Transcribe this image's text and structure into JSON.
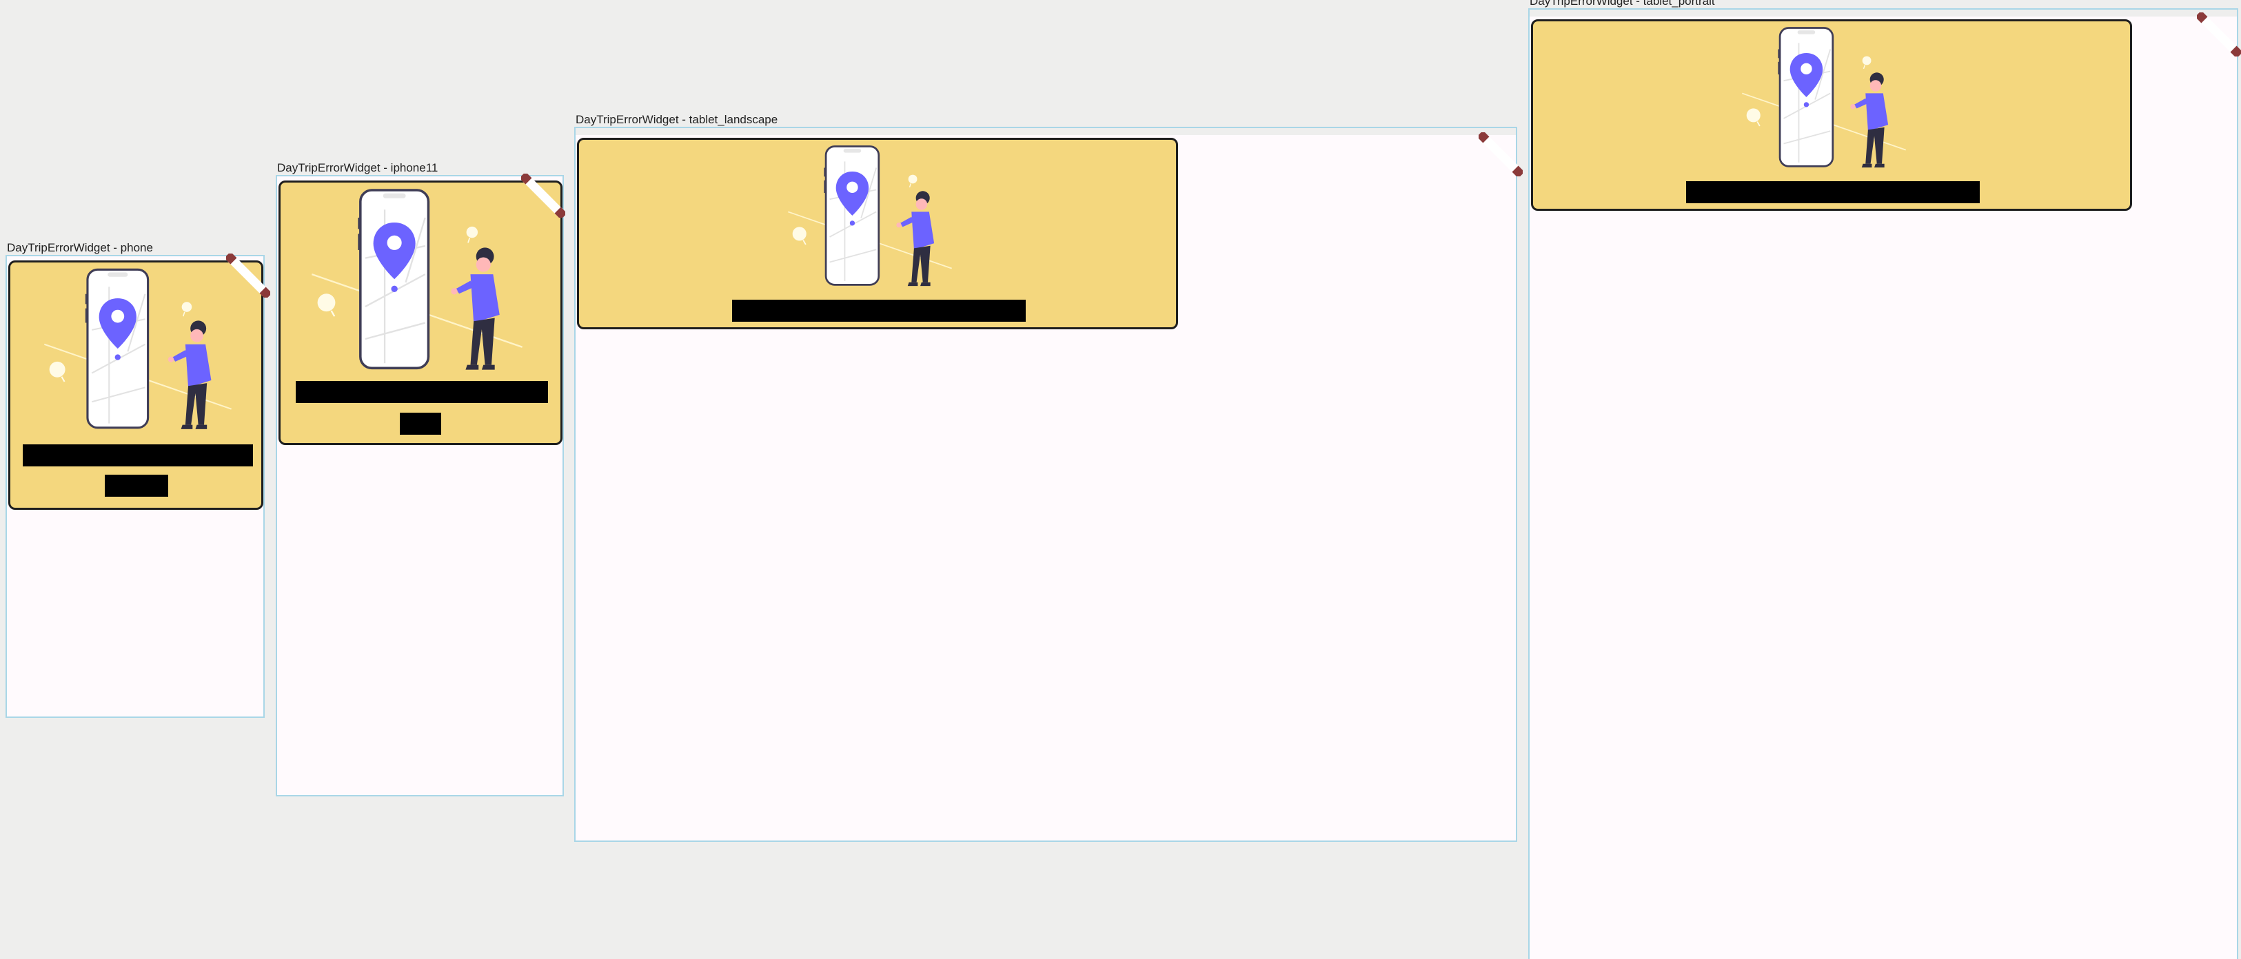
{
  "frames": [
    {
      "title": "DayTripErrorWidget - phone",
      "illustration": "location-map-error-illustration",
      "banner": "DEBUG"
    },
    {
      "title": "DayTripErrorWidget - iphone11",
      "illustration": "location-map-error-illustration",
      "banner": "DEBUG"
    },
    {
      "title": "DayTripErrorWidget - tablet_landscape",
      "illustration": "location-map-error-illustration",
      "banner": "DEBUG"
    },
    {
      "title": "DayTripErrorWidget - tablet_portrait",
      "illustration": "location-map-error-illustration",
      "banner": "DEBUG"
    }
  ],
  "colors": {
    "canvas": "#eeeeed",
    "frame_border": "#a9d6e7",
    "frame_background": "#fffafd",
    "card_background": "#f4d77e",
    "accent_purple": "#6c63ff",
    "text_redaction": "#000000",
    "debug_ribbon": "#8b3a3a"
  }
}
